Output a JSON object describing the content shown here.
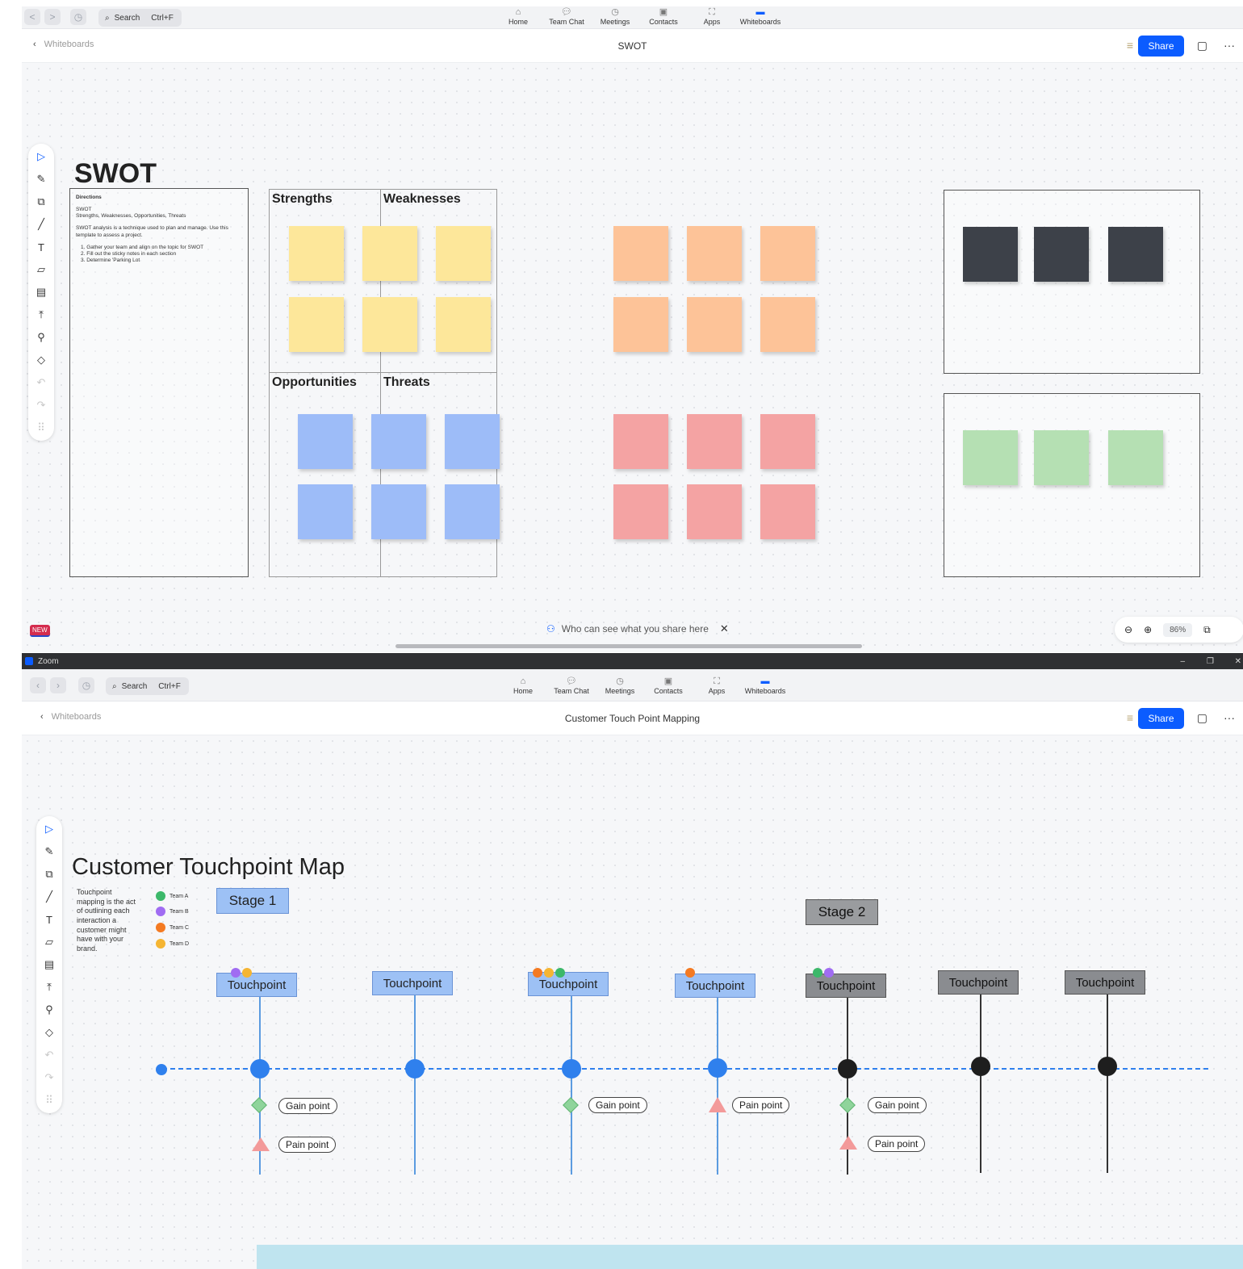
{
  "top_window": {
    "nav": {
      "back": "<",
      "forward": ">",
      "search_label": "Search",
      "search_shortcut": "Ctrl+F",
      "items": [
        {
          "label": "Home",
          "icon": "home-icon"
        },
        {
          "label": "Team Chat",
          "icon": "chat-icon"
        },
        {
          "label": "Meetings",
          "icon": "clock-icon"
        },
        {
          "label": "Contacts",
          "icon": "contacts-icon"
        },
        {
          "label": "Apps",
          "icon": "apps-icon"
        },
        {
          "label": "Whiteboards",
          "icon": "whiteboard-icon",
          "active": true
        }
      ]
    },
    "header": {
      "back_label": "Whiteboards",
      "title": "SWOT",
      "share_label": "Share"
    },
    "board": {
      "title": "SWOT",
      "directions": {
        "heading": "Directions",
        "line1": "SWOT",
        "line2": "Strengths, Weaknesses, Opportunities, Threats",
        "line3": "SWOT analysis is a technique used to plan and manage. Use this template to assess a project.",
        "steps": [
          "1. Gather your team and align on the topic for SWOT",
          "2. Fill out the sticky notes in each section",
          "3. Determine 'Parking Lot"
        ]
      },
      "quadrants": [
        "Strengths",
        "Weaknesses",
        "Opportunities",
        "Threats"
      ]
    },
    "new_badge": "NEW",
    "share_notice": "Who can see what you share here",
    "zoom_level": "86%"
  },
  "bottom_window": {
    "app_title": "Zoom",
    "nav": {
      "search_label": "Search",
      "search_shortcut": "Ctrl+F",
      "items": [
        {
          "label": "Home"
        },
        {
          "label": "Team Chat"
        },
        {
          "label": "Meetings"
        },
        {
          "label": "Contacts"
        },
        {
          "label": "Apps"
        },
        {
          "label": "Whiteboards"
        }
      ]
    },
    "header": {
      "back_label": "Whiteboards",
      "title": "Customer Touch Point Mapping",
      "share_label": "Share"
    },
    "board": {
      "title": "Customer Touchpoint Map",
      "description": "Touchpoint mapping is the act of outlining each interaction a customer might have with your brand.",
      "legend": [
        {
          "label": "Team A",
          "color": "#3cb86a"
        },
        {
          "label": "Team B",
          "color": "#a06cf2"
        },
        {
          "label": "Team C",
          "color": "#f47a22"
        },
        {
          "label": "Team D",
          "color": "#f5b533"
        }
      ],
      "stage1": "Stage 1",
      "stage2": "Stage 2",
      "touchpoint_label": "Touchpoint",
      "gain_label": "Gain point",
      "pain_label": "Pain point"
    }
  },
  "colors": {
    "accent": "#0b5cff",
    "timeline_blue": "#2f80ed",
    "stage2_dark": "#222222"
  }
}
